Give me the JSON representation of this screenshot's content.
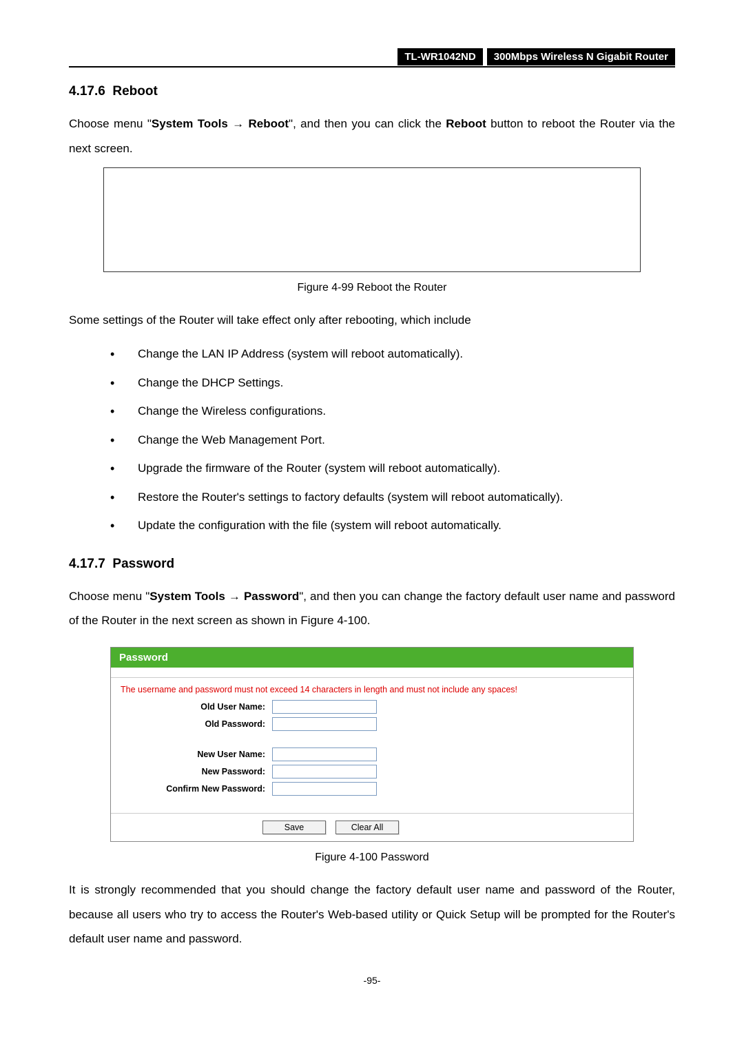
{
  "header": {
    "model": "TL-WR1042ND",
    "product": "300Mbps Wireless N Gigabit Router"
  },
  "section1": {
    "num": "4.17.6",
    "title": "Reboot",
    "intro_pre": "Choose menu \"",
    "menu1": "System Tools",
    "arrow": " → ",
    "menu2": "Reboot",
    "intro_mid": "\", and then you can click the ",
    "menu3": "Reboot",
    "intro_post": " button to reboot the Router via the next screen.",
    "caption": "Figure 4-99 Reboot the Router",
    "lead": "Some settings of the Router will take effect only after rebooting, which include",
    "bullets": [
      "Change the LAN IP Address (system will reboot automatically).",
      "Change the DHCP Settings.",
      "Change the Wireless configurations.",
      "Change the Web Management Port.",
      "Upgrade the firmware of the Router (system will reboot automatically).",
      "Restore the Router's settings to factory defaults (system will reboot automatically).",
      "Update the configuration with the file (system will reboot automatically."
    ]
  },
  "section2": {
    "num": "4.17.7",
    "title": "Password",
    "intro_pre": "Choose menu \"",
    "menu1": "System Tools",
    "arrow": " → ",
    "menu2": "Password",
    "intro_post": "\", and then you can change the factory default user name and password of the Router in the next screen as shown in Figure 4-100.",
    "caption": "Figure 4-100   Password",
    "tail": "It is strongly recommended that you should change the factory default user name and password of the Router, because all users who try to access the Router's Web-based utility or Quick Setup will be prompted for the Router's default user name and password."
  },
  "pwform": {
    "header": "Password",
    "warn": "The username and password must not exceed 14 characters in length and must not include any spaces!",
    "old_user": "Old User Name:",
    "old_pass": "Old Password:",
    "new_user": "New User Name:",
    "new_pass": "New Password:",
    "confirm": "Confirm New Password:",
    "save": "Save",
    "clear": "Clear All"
  },
  "pagenum": "-95-"
}
